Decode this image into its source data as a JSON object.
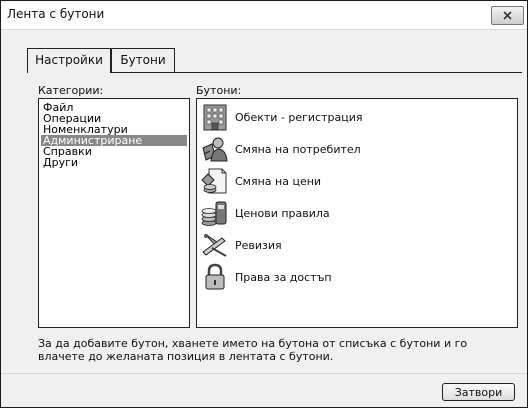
{
  "window": {
    "title": "Лента с бутони"
  },
  "tabs": [
    {
      "label": "Настройки",
      "active": true
    },
    {
      "label": "Бутони",
      "active": false
    }
  ],
  "categories": {
    "label": "Категории:",
    "items": [
      "Файл",
      "Операции",
      "Номенклатури",
      "Администриране",
      "Справки",
      "Други"
    ],
    "selected": "Администриране"
  },
  "buttons": {
    "label": "Бутони:",
    "items": [
      {
        "label": "Обекти - регистрация",
        "icon": "building-icon"
      },
      {
        "label": "Смяна на потребител",
        "icon": "change-user-icon"
      },
      {
        "label": "Смяна на цени",
        "icon": "price-change-icon"
      },
      {
        "label": "Ценови правила",
        "icon": "price-rules-icon"
      },
      {
        "label": "Ревизия",
        "icon": "revision-icon"
      },
      {
        "label": "Права за достъп",
        "icon": "padlock-icon"
      }
    ]
  },
  "hint": "За да добавите бутон, хванете името на бутона от списъка с бутони и го влачете до желаната позиция в лентата с бутони.",
  "footer": {
    "close_label": "Затвори"
  }
}
